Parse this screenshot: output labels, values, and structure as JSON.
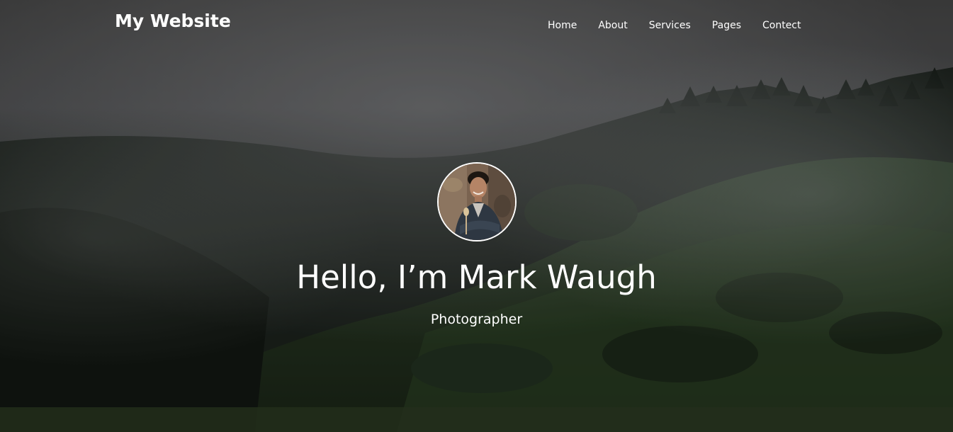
{
  "navbar": {
    "brand": "My Website",
    "links": [
      {
        "label": "Home"
      },
      {
        "label": "About"
      },
      {
        "label": "Services"
      },
      {
        "label": "Pages"
      },
      {
        "label": "Contect"
      }
    ]
  },
  "hero": {
    "title": "Hello, I’m Mark Waugh",
    "subtitle": "Photographer",
    "background": "misty-forest-hillside",
    "avatar": "profile-photo"
  },
  "colors": {
    "text": "#ffffff",
    "overlay": "#000000"
  }
}
